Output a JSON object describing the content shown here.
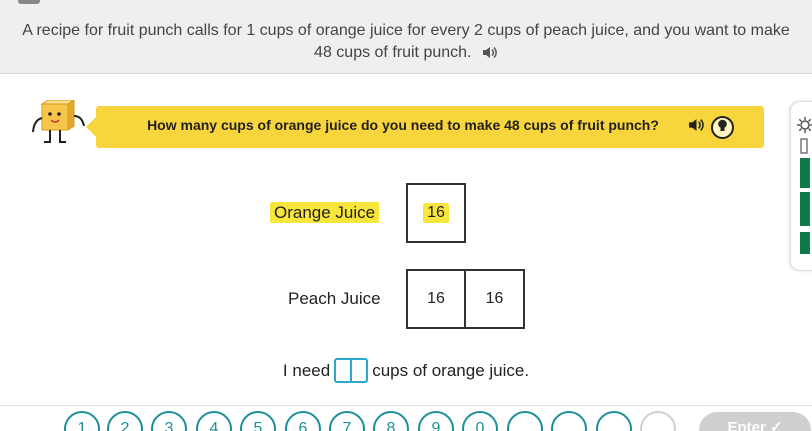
{
  "problem": {
    "text": "A recipe for fruit punch calls for 1 cups of orange juice for every 2 cups of peach juice, and you want to make 48 cups of fruit punch."
  },
  "question": {
    "text": "How many cups of orange juice do you need to make 48 cups of fruit punch?"
  },
  "tape_diagram": {
    "orange": {
      "label": "Orange Juice",
      "boxes": [
        "16"
      ]
    },
    "peach": {
      "label": "Peach Juice",
      "boxes": [
        "16",
        "16"
      ]
    }
  },
  "answer_sentence": {
    "prefix": "I need",
    "suffix": "cups of orange juice."
  },
  "keypad": {
    "keys": [
      "1",
      "2",
      "3",
      "4",
      "5",
      "6",
      "7",
      "8",
      "9",
      "0"
    ],
    "enter_label": "Enter ✓"
  },
  "colors": {
    "banner": "#f8d53d",
    "highlight": "#f8e63c",
    "keypad_accent": "#1d8f97",
    "answer_slot": "#2aa7c9",
    "side_bars": "#0e7a4a"
  },
  "icons": {
    "speaker": "speaker-icon",
    "hint": "lightbulb-icon",
    "mascot": "box-character-icon",
    "settings": "gear-icon",
    "pencil": "pencil-icon",
    "backspace": "backspace-icon"
  }
}
